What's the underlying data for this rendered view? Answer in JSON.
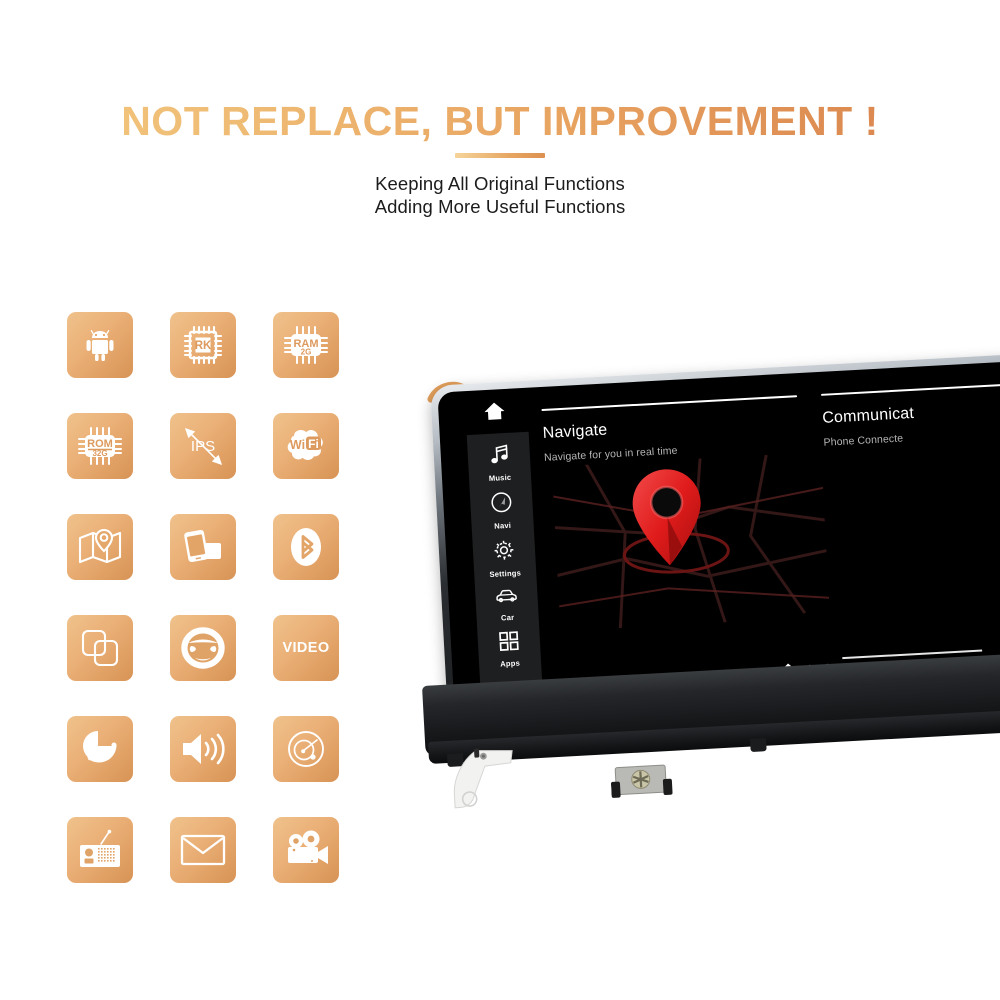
{
  "header": {
    "title": "NOT REPLACE, BUT IMPROVEMENT !",
    "subtitle_line1": "Keeping All Original Functions",
    "subtitle_line2": "Adding More Useful Functions",
    "title_gradient_start": "#f3c87f",
    "title_gradient_end": "#dd8c52"
  },
  "features": {
    "tile_gradient_start": "#f0c28c",
    "tile_gradient_end": "#d79355",
    "icon_color": "#ffffff",
    "items": [
      {
        "icon": "android-icon",
        "label": ""
      },
      {
        "icon": "cpu-chip-icon",
        "label": "RK"
      },
      {
        "icon": "ram-chip-icon",
        "label": "RAM",
        "sub": "2G"
      },
      {
        "icon": "rom-chip-icon",
        "label": "ROM",
        "sub": "32G"
      },
      {
        "icon": "ips-display-icon",
        "label": "IPS"
      },
      {
        "icon": "wifi-icon",
        "label": "Wi Fi"
      },
      {
        "icon": "map-location-icon",
        "label": ""
      },
      {
        "icon": "phone-mirror-icon",
        "label": ""
      },
      {
        "icon": "bluetooth-icon",
        "label": ""
      },
      {
        "icon": "split-screen-icon",
        "label": ""
      },
      {
        "icon": "steering-wheel-icon",
        "label": ""
      },
      {
        "icon": "video-icon",
        "label": "VIDEO"
      },
      {
        "icon": "refresh-update-icon",
        "label": ""
      },
      {
        "icon": "speaker-volume-icon",
        "label": ""
      },
      {
        "icon": "radar-gps-icon",
        "label": ""
      },
      {
        "icon": "radio-icon",
        "label": ""
      },
      {
        "icon": "mail-envelope-icon",
        "label": ""
      },
      {
        "icon": "movie-camera-icon",
        "label": ""
      }
    ]
  },
  "head_unit": {
    "wifi_signal_icon": "wifi-signal-icon",
    "wifi_signal_color": "#e09a52",
    "home_icon": "home-icon",
    "sidebar": [
      {
        "icon": "music-note-icon",
        "label": "Music"
      },
      {
        "icon": "navigation-compass-icon",
        "label": "Navi"
      },
      {
        "icon": "gear-icon",
        "label": "Settings"
      },
      {
        "icon": "car-icon",
        "label": "Car"
      },
      {
        "icon": "apps-grid-icon",
        "label": "Apps"
      }
    ],
    "cards": [
      {
        "title": "Navigate",
        "subtitle": "Navigate for you in real time"
      },
      {
        "title": "Communicat",
        "subtitle": "Phone Connecte"
      }
    ],
    "map_pin_color": "#e02020",
    "bottom_bar": {
      "home_icon": "home-icon",
      "page_dots": 2
    }
  }
}
